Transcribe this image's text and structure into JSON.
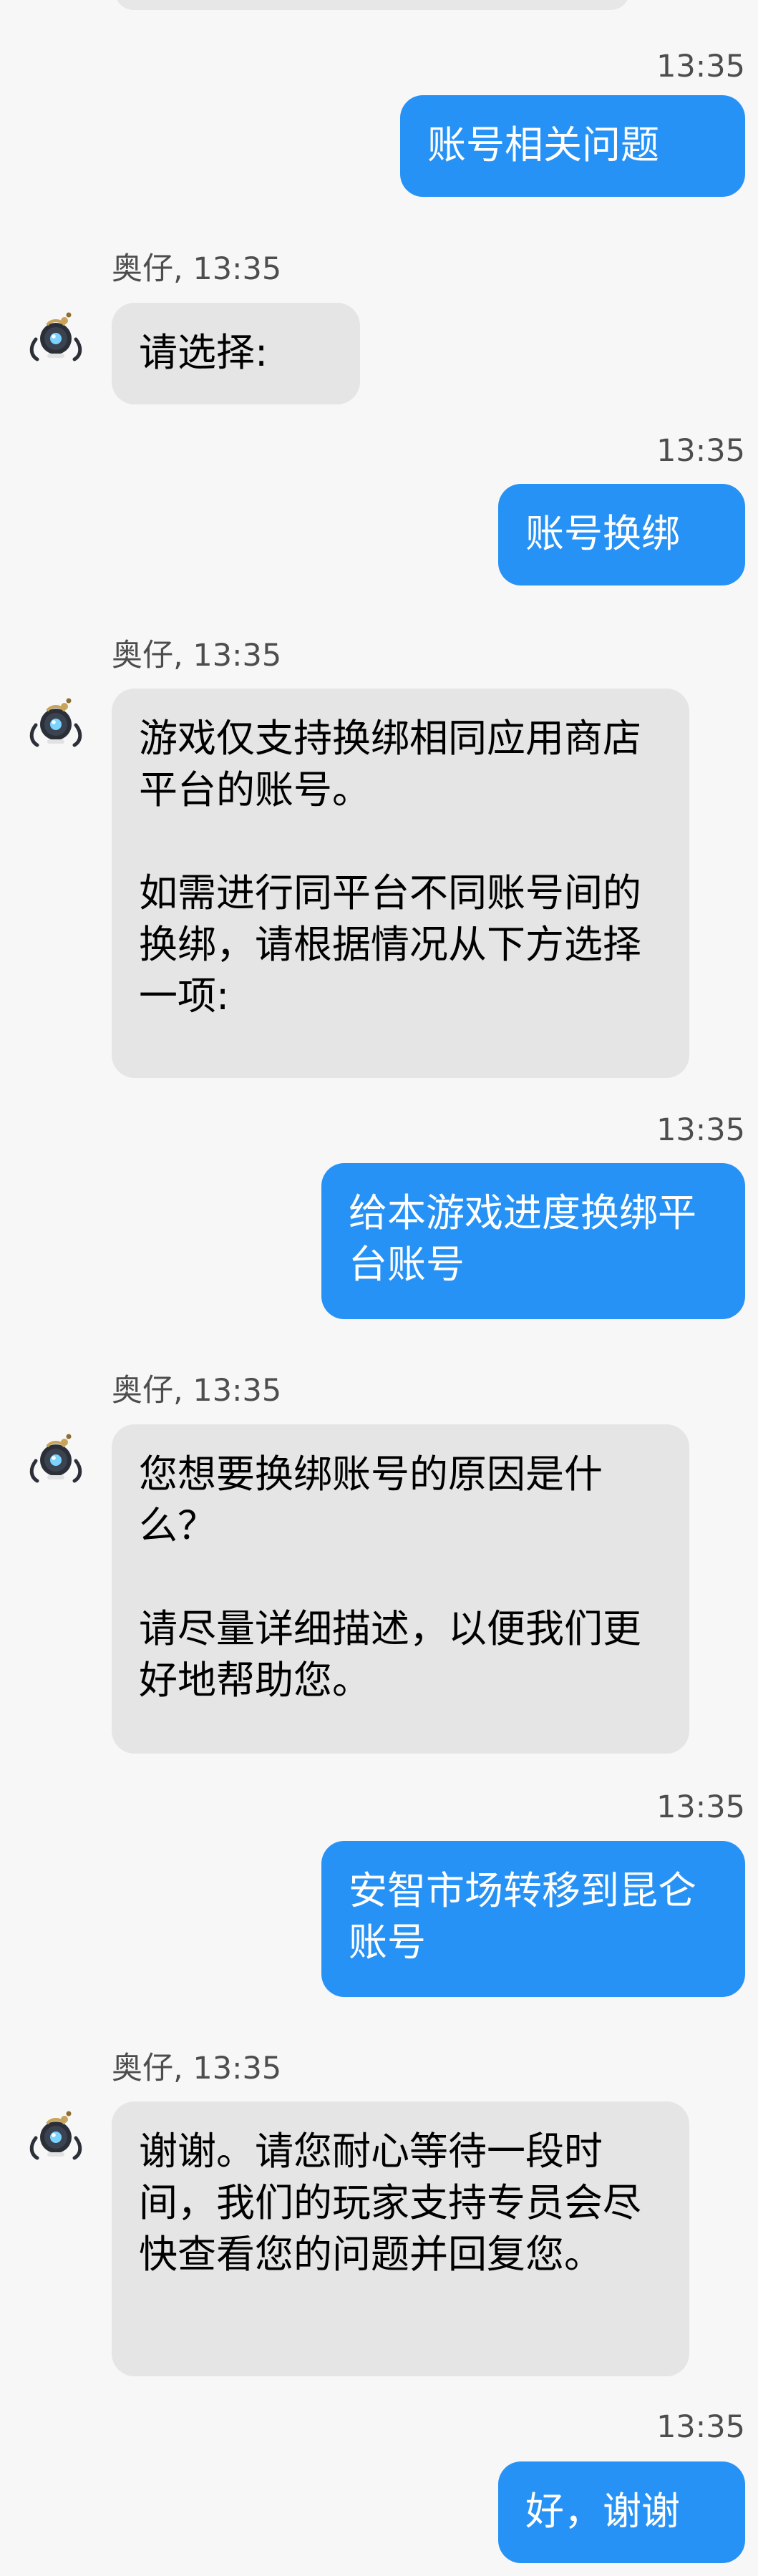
{
  "conversation": {
    "messages": [
      {
        "role": "user",
        "timestamp": "13:35",
        "text": "账号相关问题"
      },
      {
        "role": "bot",
        "sender": "奥仔, 13:35",
        "text": "请选择:"
      },
      {
        "role": "user",
        "timestamp": "13:35",
        "text": "账号换绑"
      },
      {
        "role": "bot",
        "sender": "奥仔, 13:35",
        "text": "游戏仅支持换绑相同应用商店平台的账号。\n\n如需进行同平台不同账号间的换绑，请根据情况从下方选择一项:"
      },
      {
        "role": "user",
        "timestamp": "13:35",
        "text": "给本游戏进度换绑平台账号"
      },
      {
        "role": "bot",
        "sender": "奥仔, 13:35",
        "text": "您想要换绑账号的原因是什么？\n\n请尽量详细描述，以便我们更好地帮助您。"
      },
      {
        "role": "user",
        "timestamp": "13:35",
        "text": "安智市场转移到昆仑账号"
      },
      {
        "role": "bot",
        "sender": "奥仔, 13:35",
        "text": "谢谢。请您耐心等待一段时间，我们的玩家支持专员会尽快查看您的问题并回复您。"
      },
      {
        "role": "user",
        "timestamp": "13:35",
        "text": "好，谢谢"
      }
    ]
  },
  "colors": {
    "background": "#f7f7f7",
    "user_bubble": "#2792f5",
    "bot_bubble": "#e5e5e5",
    "meta_text": "#4d4d4d"
  },
  "icons": {
    "bot_avatar": "robot-avatar-icon"
  }
}
